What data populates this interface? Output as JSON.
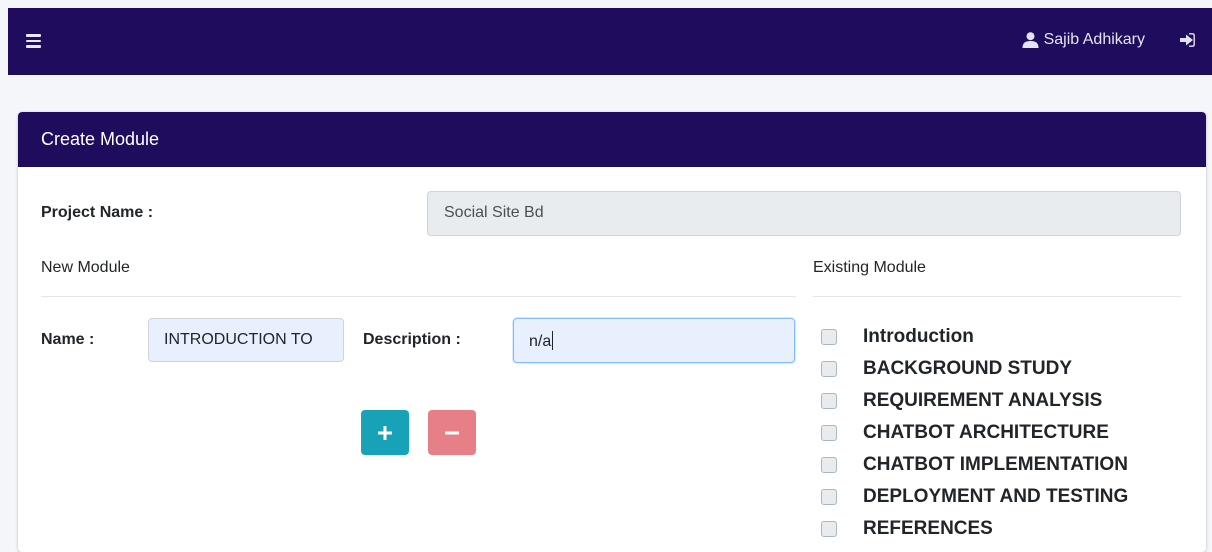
{
  "navbar": {
    "menu_icon": "hamburger-icon",
    "user_icon": "user-icon",
    "user_name": "Sajib Adhikary",
    "logout_icon": "sign-out-icon"
  },
  "card": {
    "title": "Create Module",
    "project_label": "Project Name :",
    "project_value": "Social Site Bd",
    "new_module_title": "New Module",
    "existing_module_title": "Existing Module",
    "name_label": "Name :",
    "name_value": "INTRODUCTION TO",
    "description_label": "Description :",
    "description_value": "n/a",
    "add_icon": "plus-icon",
    "remove_icon": "minus-icon"
  },
  "existing_modules": [
    "Introduction",
    "BACKGROUND STUDY",
    "REQUIREMENT ANALYSIS",
    "CHATBOT ARCHITECTURE",
    "CHATBOT IMPLEMENTATION",
    "DEPLOYMENT AND TESTING",
    "REFERENCES"
  ],
  "colors": {
    "navbar": "#1f0c5c",
    "card_header": "#1f0c5c",
    "add_button": "#17a2b8",
    "remove_button": "#e77f87"
  }
}
